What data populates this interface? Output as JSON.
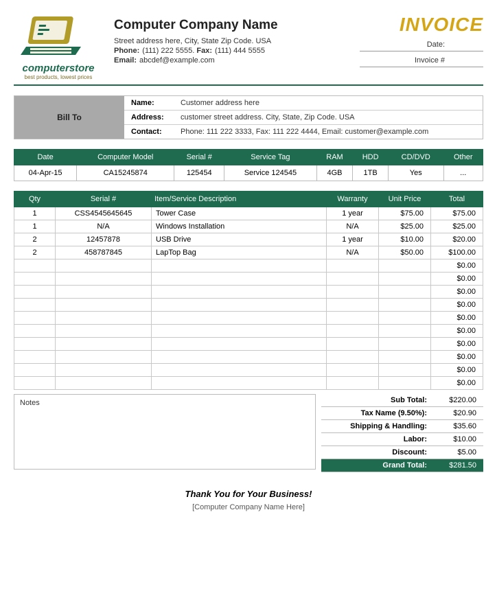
{
  "logo": {
    "store_name": "computerstore",
    "tagline": "best products, lowest prices"
  },
  "company": {
    "name": "Computer Company Name",
    "address": "Street address here, City, State Zip Code. USA",
    "phone_label": "Phone:",
    "phone": "(111) 222 5555.",
    "fax_label": "Fax:",
    "fax": "(111) 444 5555",
    "email_label": "Email:",
    "email": "abcdef@example.com"
  },
  "invoice": {
    "title": "INVOICE",
    "date_label": "Date:",
    "date_value": "",
    "number_label": "Invoice #",
    "number_value": ""
  },
  "bill_to": {
    "heading": "Bill To",
    "name_label": "Name:",
    "name": "Customer address here",
    "address_label": "Address:",
    "address": "customer street address. City, State, Zip Code. USA",
    "contact_label": "Contact:",
    "contact": "Phone: 111 222 3333, Fax: 111 222 4444, Email: customer@example.com"
  },
  "spec_headers": {
    "date": "Date",
    "model": "Computer Model",
    "serial": "Serial #",
    "service_tag": "Service Tag",
    "ram": "RAM",
    "hdd": "HDD",
    "cddvd": "CD/DVD",
    "other": "Other"
  },
  "spec_row": {
    "date": "04-Apr-15",
    "model": "CA15245874",
    "serial": "125454",
    "service_tag": "Service 124545",
    "ram": "4GB",
    "hdd": "1TB",
    "cddvd": "Yes",
    "other": "..."
  },
  "item_headers": {
    "qty": "Qty",
    "serial": "Serial #",
    "desc": "Item/Service Description",
    "warranty": "Warranty",
    "unit": "Unit Price",
    "total": "Total"
  },
  "items": [
    {
      "qty": "1",
      "serial": "CSS4545645645",
      "desc": "Tower Case",
      "warranty": "1 year",
      "unit": "$75.00",
      "total": "$75.00"
    },
    {
      "qty": "1",
      "serial": "N/A",
      "desc": "Windows Installation",
      "warranty": "N/A",
      "unit": "$25.00",
      "total": "$25.00"
    },
    {
      "qty": "2",
      "serial": "12457878",
      "desc": "USB Drive",
      "warranty": "1 year",
      "unit": "$10.00",
      "total": "$20.00"
    },
    {
      "qty": "2",
      "serial": "458787845",
      "desc": "LapTop Bag",
      "warranty": "N/A",
      "unit": "$50.00",
      "total": "$100.00"
    },
    {
      "qty": "",
      "serial": "",
      "desc": "",
      "warranty": "",
      "unit": "",
      "total": "$0.00"
    },
    {
      "qty": "",
      "serial": "",
      "desc": "",
      "warranty": "",
      "unit": "",
      "total": "$0.00"
    },
    {
      "qty": "",
      "serial": "",
      "desc": "",
      "warranty": "",
      "unit": "",
      "total": "$0.00"
    },
    {
      "qty": "",
      "serial": "",
      "desc": "",
      "warranty": "",
      "unit": "",
      "total": "$0.00"
    },
    {
      "qty": "",
      "serial": "",
      "desc": "",
      "warranty": "",
      "unit": "",
      "total": "$0.00"
    },
    {
      "qty": "",
      "serial": "",
      "desc": "",
      "warranty": "",
      "unit": "",
      "total": "$0.00"
    },
    {
      "qty": "",
      "serial": "",
      "desc": "",
      "warranty": "",
      "unit": "",
      "total": "$0.00"
    },
    {
      "qty": "",
      "serial": "",
      "desc": "",
      "warranty": "",
      "unit": "",
      "total": "$0.00"
    },
    {
      "qty": "",
      "serial": "",
      "desc": "",
      "warranty": "",
      "unit": "",
      "total": "$0.00"
    },
    {
      "qty": "",
      "serial": "",
      "desc": "",
      "warranty": "",
      "unit": "",
      "total": "$0.00"
    }
  ],
  "notes_label": "Notes",
  "totals": {
    "subtotal_label": "Sub Total:",
    "subtotal": "$220.00",
    "tax_label": "Tax Name (9.50%):",
    "tax": "$20.90",
    "ship_label": "Shipping & Handling:",
    "ship": "$35.60",
    "labor_label": "Labor:",
    "labor": "$10.00",
    "discount_label": "Discount:",
    "discount": "$5.00",
    "grand_label": "Grand Total:",
    "grand": "$281.50"
  },
  "footer": {
    "thanks": "Thank You for Your Business!",
    "company": "[Computer Company Name Here]"
  }
}
